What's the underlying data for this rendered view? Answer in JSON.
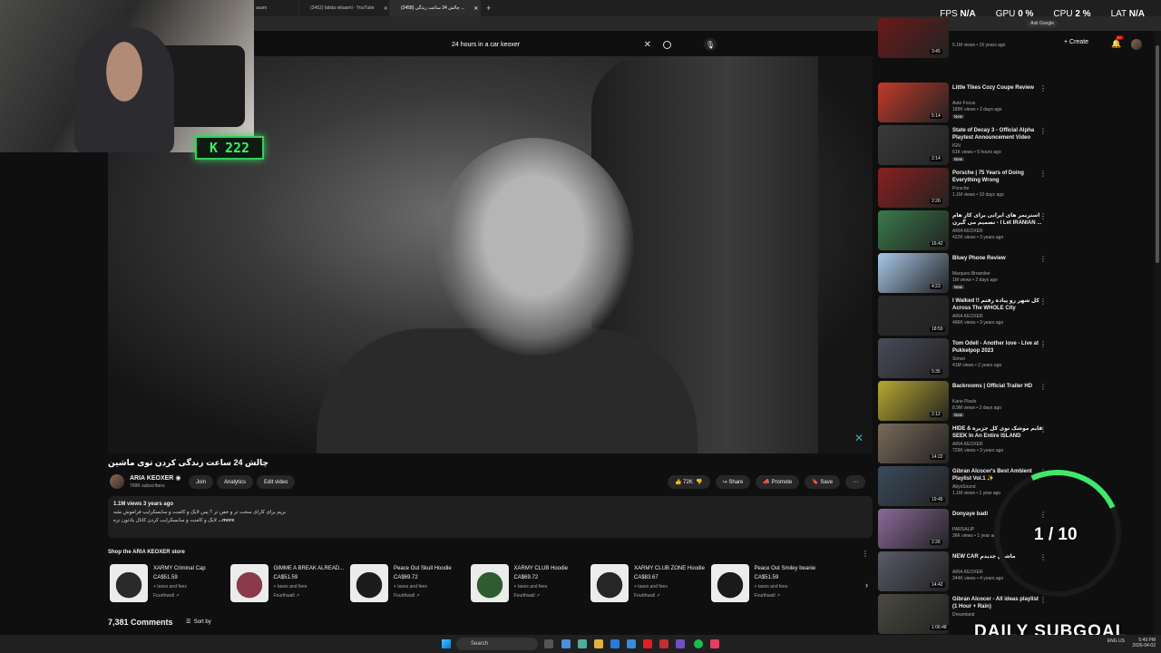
{
  "browser": {
    "tabs": [
      {
        "label": "(3452) fatida nikaami - YouTube",
        "active": false
      },
      {
        "label": "(3458) چالش 24 ساعت زندگی ...",
        "active": true
      }
    ],
    "tab_prefix": "asam",
    "new_tab": "+"
  },
  "perf": {
    "fps_label": "FPS",
    "fps_value": "N/A",
    "gpu_label": "GPU",
    "gpu_value": "0 %",
    "cpu_label": "CPU",
    "cpu_value": "2 %",
    "lat_label": "LAT",
    "lat_value": "N/A",
    "ask_google": "Ask Google"
  },
  "header": {
    "search_value": "24 hours in a car keoxer",
    "clear": "✕",
    "mic": "🎙",
    "create": "+ Create",
    "notif_count": "9+"
  },
  "webcam": {
    "k_label": "K",
    "k_value": "222"
  },
  "video": {
    "title": "چالش 24 ساعت زندگی کردن توی ماشین",
    "channel": "ARIA KEOXER",
    "verified": "◉",
    "subscribers": "768K subscribers",
    "join": "Join",
    "analytics": "Analytics",
    "edit": "Edit video",
    "likes": "72K",
    "share": "Share",
    "promote": "Promote",
    "save": "Save",
    "more": "⋯"
  },
  "description": {
    "meta": "1.1M views  3 years ago",
    "line1": "بریم برای کارای سخت تر و خفن تر ؟ پس لایک و کامنت و سابسکرایب فراموش نشه",
    "line2": "لایک و کامنت و سابسکرایب کردن کانال یادتون نره",
    "more": "...more"
  },
  "shop": {
    "title": "Shop the ARIA KEOXER store",
    "tax": "+ taxes and fees",
    "vendor": "Fourthwall ↗",
    "products": [
      {
        "name": "XARMY Criminal Cap",
        "price": "CA$51.59",
        "color": "#2a2a2a"
      },
      {
        "name": "GIMME A BREAK ALREAD...",
        "price": "CA$51.59",
        "color": "#8b3a4a"
      },
      {
        "name": "Peace Out Skull Hoodie",
        "price": "CA$69.72",
        "color": "#1c1c1c"
      },
      {
        "name": "XARMY CLUB Hoodie",
        "price": "CA$69.72",
        "color": "#2f5b30"
      },
      {
        "name": "XARMY CLUB ZONE Hoodie",
        "price": "CA$83.67",
        "color": "#262626"
      },
      {
        "name": "Peace Out Smiley beanie",
        "price": "CA$51.59",
        "color": "#1a1a1a"
      }
    ]
  },
  "comments": {
    "count": "7,381 Comments",
    "sort": "Sort by"
  },
  "recommendations": [
    {
      "title": "",
      "channel": "",
      "views": "5.1M views • 15 years ago",
      "duration": "3:45",
      "new": "",
      "color": "#6a1a1a"
    },
    {
      "title": "Little Tikes Cozy Coupe Review",
      "channel": "Auto Focus",
      "views": "189K views • 2 days ago",
      "duration": "5:14",
      "new": "New",
      "color": "#c23a2a"
    },
    {
      "title": "State of Decay 3 - Official Alpha Playtest Announcement Video",
      "channel": "IGN",
      "views": "61K views • 5 hours ago",
      "duration": "2:14",
      "new": "New",
      "color": "#3a3a3a"
    },
    {
      "title": "Porsche | 75 Years of Doing Everything Wrong",
      "channel": "Porsche",
      "views": "1.1M views • 10 days ago",
      "duration": "2:26",
      "new": "",
      "color": "#8a1f1f"
    },
    {
      "title": "استریمر های ایرانی برای کار هام تصمیم می گیرن - I Let IRANIAN ...",
      "channel": "ARIA KEOXER",
      "views": "422K views • 3 years ago",
      "duration": "16:42",
      "new": "",
      "color": "#3a7a4a"
    },
    {
      "title": "Bluey Phone Review",
      "channel": "Marques Brownlee",
      "views": "1M views • 2 days ago",
      "duration": "4:23",
      "new": "New",
      "color": "#a8c8e8"
    },
    {
      "title": "I Walked !! کل شهر رو پیاده رفتم Across The WHOLE City",
      "channel": "ARIA KEOXER",
      "views": "496K views • 3 years ago",
      "duration": "18:50",
      "new": "",
      "color": "#2a2a2a"
    },
    {
      "title": "Tom Odell - Another love - Live at Pukkelpop 2023",
      "channel": "Simon",
      "views": "41M views • 2 years ago",
      "duration": "5:35",
      "new": "",
      "color": "#4a4a5a"
    },
    {
      "title": "Backrooms | Official Trailer HD",
      "channel": "Kane Pixels",
      "views": "8.9M views • 3 days ago",
      "duration": "2:12",
      "new": "New",
      "color": "#b8a830"
    },
    {
      "title": "HIDE & قایم موشک توی کل جزیره SEEK In An Entire ISLAND",
      "channel": "ARIA KEOXER",
      "views": "729K views • 3 years ago",
      "duration": "14:22",
      "new": "",
      "color": "#7a6a5a"
    },
    {
      "title": "Gibran Alcocer's Best Ambient Playlist Vol.1 ✨",
      "channel": "AbysSound",
      "views": "1.1M views • 1 year ago",
      "duration": "19:45",
      "new": "",
      "color": "#3a4a5a"
    },
    {
      "title": "Donyaye badi",
      "channel": "PARSALIP",
      "views": "36K views • 1 year ago",
      "duration": "2:26",
      "new": "",
      "color": "#8a6a9a"
    },
    {
      "title": "NEW CAR ماشین جدیدم",
      "channel": "ARIA KEOXER",
      "views": "344K views • 4 years ago",
      "duration": "14:42",
      "new": "",
      "color": "#5a5a6a"
    },
    {
      "title": "Gibran Alcocer - All ideas playlist (1 Hour + Rain)",
      "channel": "Dreamland",
      "views": "",
      "duration": "1:06:48",
      "new": "",
      "color": "#4a4a40"
    }
  ],
  "overlay": {
    "goal": "1 / 10",
    "subgoal": "DAILY SUBGOAL"
  },
  "taskbar": {
    "search": "Search",
    "lang": "ENG US",
    "time": "5:49 PM",
    "date": "2026-04-02"
  }
}
